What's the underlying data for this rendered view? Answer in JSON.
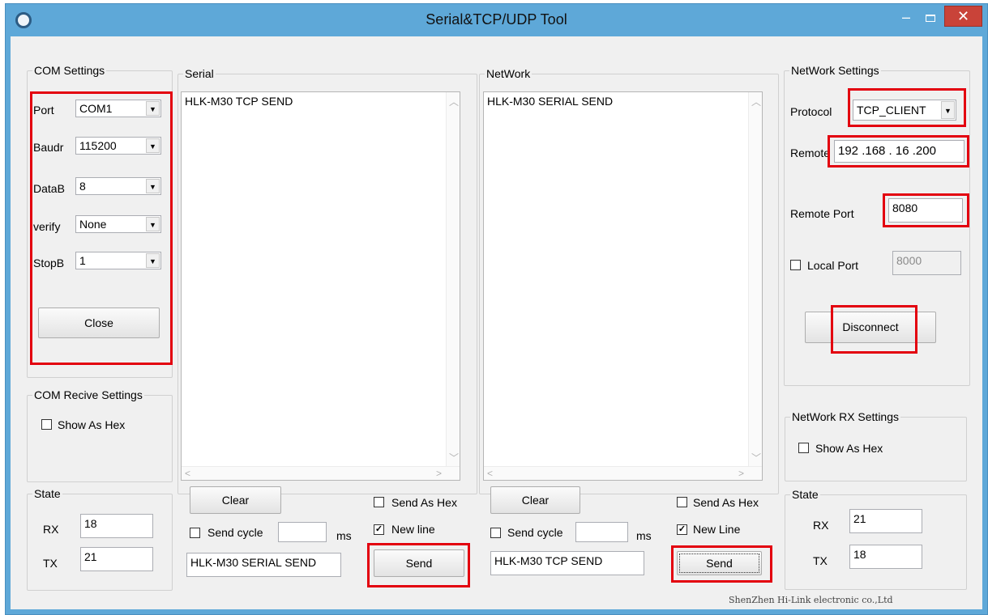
{
  "window": {
    "title": "Serial&TCP/UDP Tool",
    "minimize_glyph": "–",
    "close_glyph": "✕"
  },
  "com_settings": {
    "title": "COM Settings",
    "port_label": "Port",
    "port_value": "COM1",
    "baud_label": "Baudr",
    "baud_value": "115200",
    "data_label": "DataB",
    "data_value": "8",
    "verify_label": "verify",
    "verify_value": "None",
    "stop_label": "StopB",
    "stop_value": "1",
    "close_button": "Close"
  },
  "com_receive": {
    "title": "COM Recive Settings",
    "show_hex_label": "Show As Hex",
    "show_hex_checked": false
  },
  "com_state": {
    "title": "State",
    "rx_label": "RX",
    "rx_value": "18",
    "tx_label": "TX",
    "tx_value": "21"
  },
  "serial": {
    "title": "Serial",
    "received_text": "HLK-M30 TCP SEND",
    "clear_button": "Clear",
    "send_as_hex_label": "Send As Hex",
    "send_as_hex_checked": false,
    "new_line_label": "New line",
    "new_line_checked": true,
    "send_cycle_label": "Send cycle",
    "send_cycle_value": "",
    "ms_label": "ms",
    "send_input_value": "HLK-M30 SERIAL SEND",
    "send_button": "Send"
  },
  "network": {
    "title": "NetWork",
    "received_text": "HLK-M30 SERIAL SEND",
    "clear_button": "Clear",
    "send_as_hex_label": "Send As Hex",
    "send_as_hex_checked": false,
    "new_line_label": "New Line",
    "new_line_checked": true,
    "send_cycle_label": "Send cycle",
    "send_cycle_value": "",
    "ms_label": "ms",
    "send_input_value": "HLK-M30 TCP SEND",
    "send_button": "Send"
  },
  "network_settings": {
    "title": "NetWork Settings",
    "protocol_label": "Protocol",
    "protocol_value": "TCP_CLIENT",
    "remote_label": "Remote",
    "remote_ip": "192 .168 . 16 .200",
    "remote_port_label": "Remote Port",
    "remote_port_value": "8080",
    "local_port_label": "Local Port",
    "local_port_checked": false,
    "local_port_value": "8000",
    "disconnect_button": "Disconnect"
  },
  "network_rx": {
    "title": "NetWork RX Settings",
    "show_hex_label": "Show As Hex",
    "show_hex_checked": false
  },
  "net_state": {
    "title": "State",
    "rx_label": "RX",
    "rx_value": "21",
    "tx_label": "TX",
    "tx_value": "18"
  },
  "footer": {
    "company": "ShenZhen Hi-Link electronic co.,Ltd"
  },
  "colors": {
    "titlebar": "#5ea8d8",
    "close_button": "#c94339",
    "highlight": "#e3000f",
    "client_bg": "#f0f0f0"
  }
}
